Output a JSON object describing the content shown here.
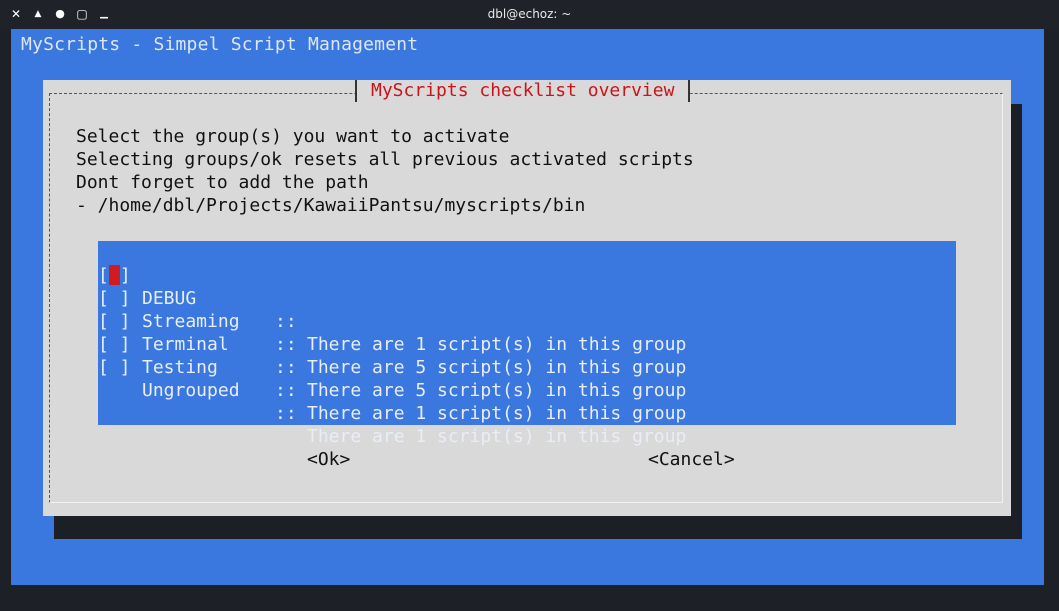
{
  "window": {
    "title": "dbl@echoz: ~",
    "controls": [
      {
        "icon": "close-icon",
        "glyph": "✕"
      },
      {
        "icon": "maximize-up-icon",
        "glyph": "▲"
      },
      {
        "icon": "sticky-dot-icon",
        "glyph": "●"
      },
      {
        "icon": "restore-icon",
        "glyph": "▢"
      },
      {
        "icon": "minimize-icon",
        "glyph": "▁"
      }
    ]
  },
  "backtitle": "MyScripts - Simpel Script Management",
  "dialog": {
    "title": "MyScripts checklist overview",
    "prompt_lines": [
      "Select the group(s) you want to activate",
      "Selecting groups/ok resets all previous activated scripts",
      "Dont forget to add the path",
      "- /home/dbl/Projects/KawaiiPantsu/myscripts/bin"
    ],
    "items": [
      {
        "checkbox": "[ ]",
        "name": "DEBUG",
        "sep": "::",
        "desc": "There are 1 script(s) in this group",
        "focused": true
      },
      {
        "checkbox": "[ ]",
        "name": "Streaming",
        "sep": "::",
        "desc": "There are 5 script(s) in this group",
        "focused": false
      },
      {
        "checkbox": "[ ]",
        "name": "Terminal",
        "sep": "::",
        "desc": "There are 5 script(s) in this group",
        "focused": false
      },
      {
        "checkbox": "[ ]",
        "name": "Testing",
        "sep": "::",
        "desc": "There are 1 script(s) in this group",
        "focused": false
      },
      {
        "checkbox": "[ ]",
        "name": "Ungrouped",
        "sep": "::",
        "desc": "There are 1 script(s) in this group",
        "focused": false
      }
    ],
    "ok_label": "<Ok>",
    "cancel_label": "<Cancel>"
  },
  "colors": {
    "terminal_bg": "#3a78e0",
    "dialog_bg": "#d9d9d9",
    "title_red": "#c9141b",
    "cursor_red": "#d11b22"
  }
}
